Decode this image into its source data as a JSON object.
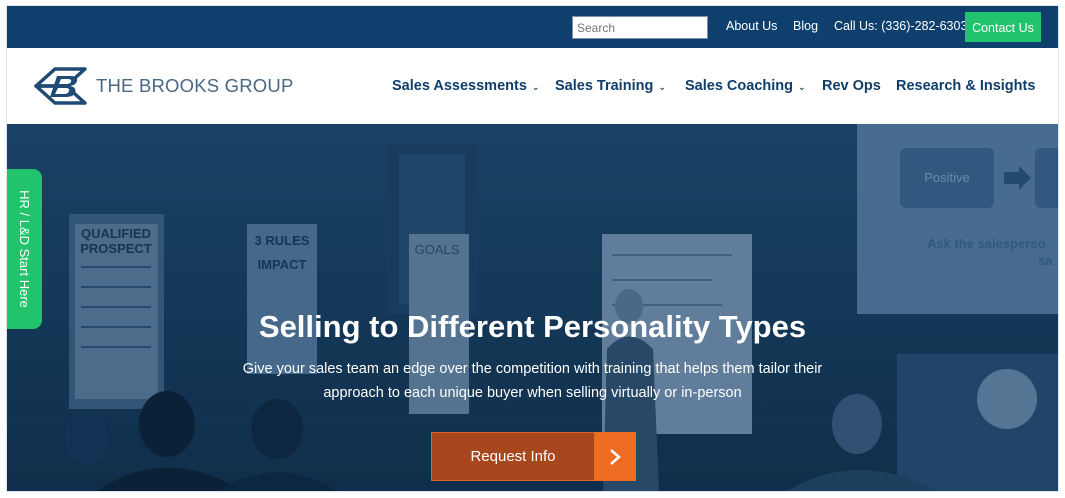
{
  "topbar": {
    "search_placeholder": "Search",
    "links": [
      "About Us",
      "Blog",
      "Call Us: (336)-282-6303"
    ],
    "contact_label": "Contact Us"
  },
  "logo": {
    "text": "THE BROOKS GROUP"
  },
  "nav": {
    "items": [
      {
        "label": "Sales Assessments",
        "has_dropdown": true
      },
      {
        "label": "Sales Training",
        "has_dropdown": true
      },
      {
        "label": "Sales Coaching",
        "has_dropdown": true
      },
      {
        "label": "Rev Ops",
        "has_dropdown": false
      },
      {
        "label": "Research & Insights",
        "has_dropdown": false
      }
    ]
  },
  "hero": {
    "title": "Selling to Different Personality Types",
    "subtitle_line1": "Give your sales team an edge over the competition with training that helps them tailor their",
    "subtitle_line2": "approach to each unique buyer when selling virtually or in-person",
    "cta_label": "Request Info",
    "background_text": {
      "poster_1_heading_a": "QUALIFIED",
      "poster_1_heading_b": "PROSPECT",
      "poster_2_heading_a": "3 RULES",
      "poster_2_heading_b": "IMPACT",
      "board_word": "GOALS",
      "screen_box": "Positive",
      "screen_line_1": "Ask the salesperso",
      "screen_line_2": "sa"
    }
  },
  "side_tab": {
    "label": "HR / L&D Start Here"
  },
  "colors": {
    "topbar": "#0f406d",
    "nav_text": "#103e6a",
    "green": "#21c46c",
    "orange": "#ef6c23",
    "hero_overlay": "#143c63"
  },
  "icons": {
    "cta_arrow": "chevron-right-icon",
    "dropdown": "chevron-down-icon",
    "logo_mark": "brooks-b-logo"
  }
}
